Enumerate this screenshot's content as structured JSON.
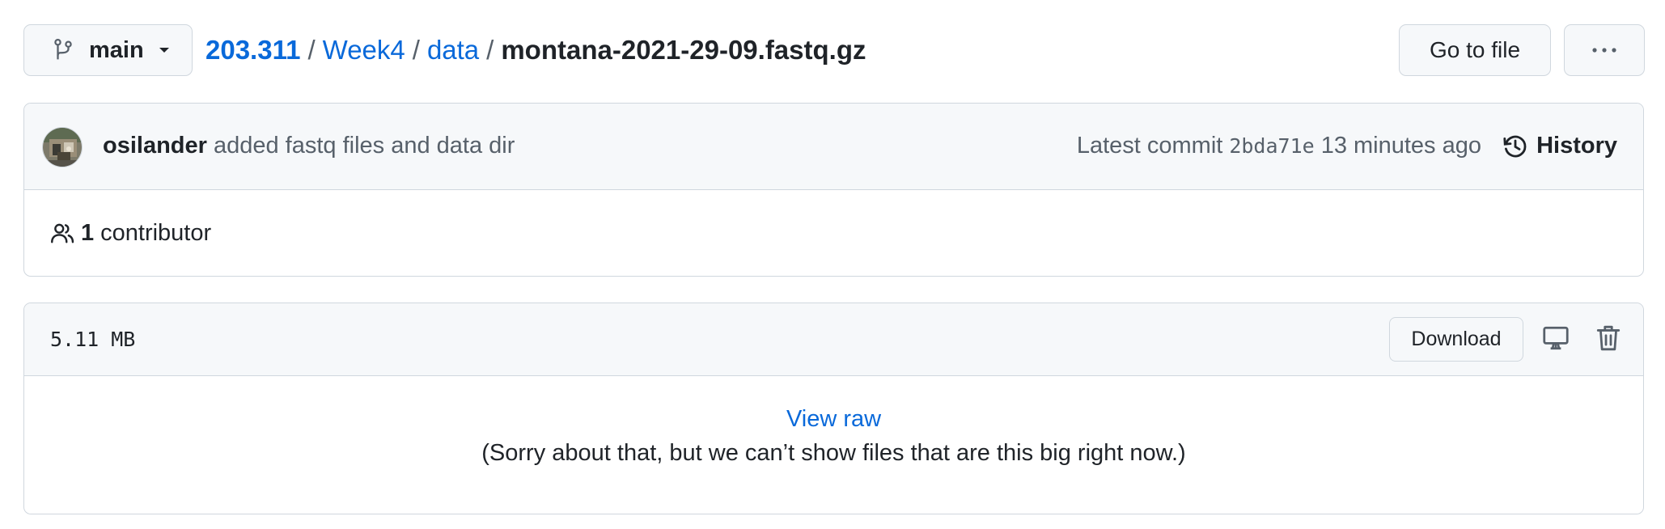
{
  "branch": {
    "name": "main",
    "icon": "git-branch-icon"
  },
  "breadcrumb": {
    "repo": "203.311",
    "folder1": "Week4",
    "folder2": "data",
    "file": "montana-2021-29-09.fastq.gz",
    "separator": "/"
  },
  "actions": {
    "go_to_file": "Go to file",
    "more_icon": "kebab-horizontal-icon"
  },
  "commit": {
    "author": "osilander",
    "message": "added fastq files and data dir",
    "latest_label": "Latest commit",
    "sha": "2bda71e",
    "time": "13 minutes ago",
    "history_label": "History"
  },
  "contributors": {
    "count": "1",
    "label": "contributor"
  },
  "file": {
    "size": "5.11 MB",
    "download_label": "Download",
    "view_raw_label": "View raw",
    "too_big_message": "(Sorry about that, but we can’t show files that are this big right now.)"
  },
  "colors": {
    "link": "#0969da",
    "text": "#1f2328",
    "muted": "#57606a",
    "border": "#d0d7de",
    "header_bg": "#f6f8fa"
  }
}
